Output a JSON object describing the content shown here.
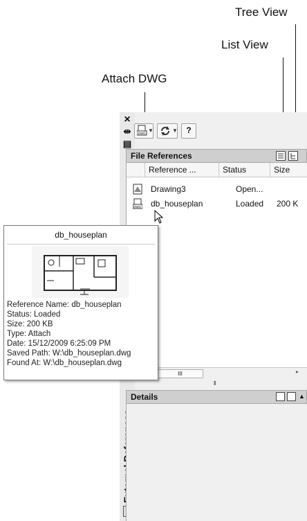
{
  "callouts": {
    "tree_view": "Tree View",
    "list_view": "List View",
    "attach_dwg": "Attach DWG"
  },
  "palette": {
    "title": "External References",
    "close_glyph": "×",
    "autohide_glyph": "⇹",
    "properties_glyph": "▤",
    "toolbar": {
      "attach_icon": "attach-dwg-icon",
      "refresh_icon": "refresh-icon",
      "help_glyph": "?"
    },
    "file_references": {
      "header": "File References",
      "columns": [
        "Reference ...",
        "Status",
        "Size"
      ],
      "rows": [
        {
          "name": "Drawing3",
          "status": "Open...",
          "size": ""
        },
        {
          "name": "db_houseplan",
          "status": "Loaded",
          "size": "200 K"
        }
      ],
      "scroll_thumb": "III"
    },
    "details": {
      "header": "Details"
    }
  },
  "tooltip": {
    "title": "db_houseplan",
    "lines": [
      "Reference Name: db_houseplan",
      "Status: Loaded",
      "Size: 200 KB",
      "Type: Attach",
      "Date: 15/12/2009 6:25:09 PM",
      "Saved Path: W:\\db_houseplan.dwg",
      "Found At: W:\\db_houseplan.dwg"
    ]
  }
}
